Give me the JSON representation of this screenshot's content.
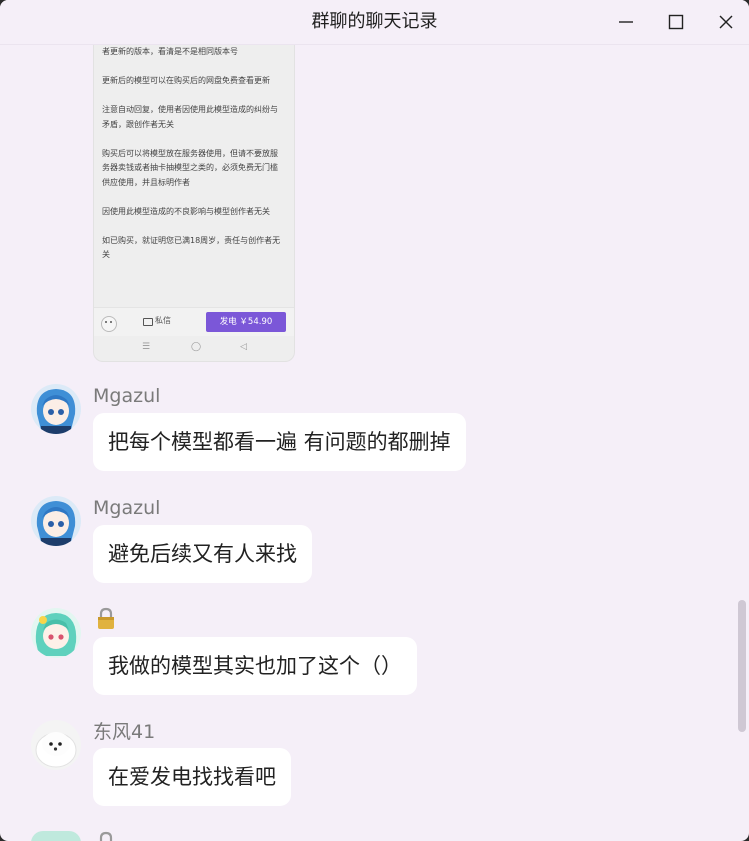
{
  "window": {
    "title": "群聊的聊天记录"
  },
  "shared_image": {
    "paragraphs": [
      "者更新的版本，看清是不是相同版本号",
      "更新后的模型可以在购买后的网盘免费查看更新",
      "注意自动回复，使用者因使用此模型造成的纠纷与矛盾，跟创作者无关",
      "购买后可以将模型放在服务器使用，但请不要放服务器卖钱或者抽卡抽模型之类的，必须免费无门槛供应使用，并且标明作者",
      "因使用此模型造成的不良影响与模型创作者无关",
      "如已购买，就证明您已满18周岁，责任与创作者无关"
    ],
    "message_label": "私信",
    "buy_label": "发电 ￥54.90"
  },
  "messages": [
    {
      "sender": "Mgazul",
      "text": "把每个模型都看一遍 有问题的都删掉",
      "avatar": "blue-hair-anime-avatar"
    },
    {
      "sender": "Mgazul",
      "text": "避免后续又有人来找",
      "avatar": "blue-hair-anime-avatar"
    },
    {
      "sender": "",
      "sender_icon": "lock-icon",
      "text": "我做的模型其实也加了这个（）",
      "avatar": "teal-hair-anime-avatar"
    },
    {
      "sender": "东风41",
      "text": "在爱发电找找看吧",
      "avatar": "white-dog-avatar"
    }
  ],
  "colors": {
    "background": "#f5eff8",
    "bubble": "#ffffff",
    "sender_name": "#7a7a7a",
    "buy_button": "#7b57d8"
  }
}
